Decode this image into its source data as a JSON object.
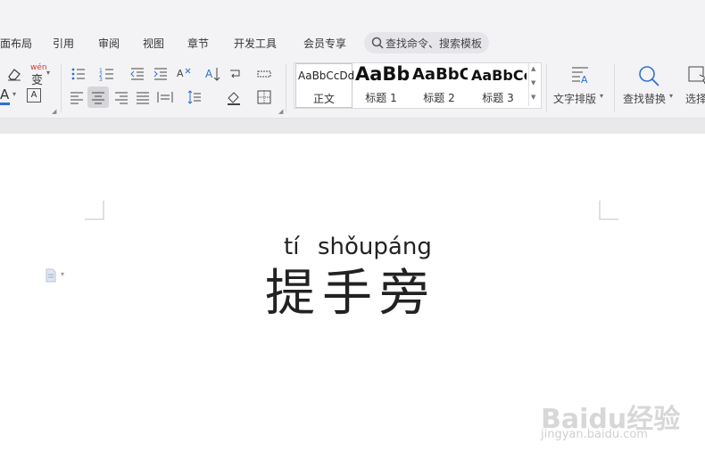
{
  "menu": {
    "items": [
      "面布局",
      "引用",
      "审阅",
      "视图",
      "章节",
      "开发工具",
      "会员专享"
    ],
    "search_placeholder": "查找命令、搜索模板"
  },
  "toolbar": {
    "format_labels": {
      "phonetic_guide": "wén",
      "char_shading": "A"
    },
    "styles": [
      {
        "sample": "AaBbCcDd",
        "name": "正文"
      },
      {
        "sample": "AaBb",
        "name": "标题 1"
      },
      {
        "sample": "AaBbC",
        "name": "标题 2"
      },
      {
        "sample": "AaBbCc",
        "name": "标题 3"
      }
    ],
    "text_layout_label": "文字排版",
    "find_replace_label": "查找替换",
    "select_label": "选择"
  },
  "document": {
    "pinyin_1": "tí",
    "pinyin_2": "shǒupáng",
    "hanzi": "提手旁"
  },
  "watermark": {
    "logo_text": "Baidu经验",
    "url": "jingyan.baidu.com"
  },
  "colors": {
    "accent_blue": "#2f6fd8",
    "toolbar_bg": "#f3f3f5",
    "active_btn": "#d6d6da"
  }
}
